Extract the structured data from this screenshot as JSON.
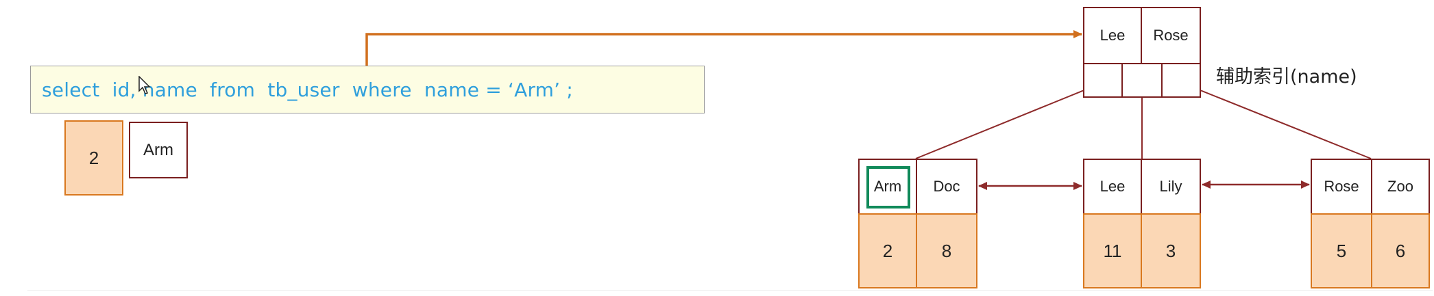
{
  "query": {
    "sql": "select  id, name  from  tb_user  where  name = ‘Arm’ ;"
  },
  "result_row": {
    "id": "2",
    "name": "Arm"
  },
  "index": {
    "label": "辅助索引(name)",
    "root": {
      "keys": [
        "Lee",
        "Rose"
      ]
    },
    "leaves": [
      {
        "keys": [
          "Arm",
          "Doc"
        ],
        "values": [
          "2",
          "8"
        ]
      },
      {
        "keys": [
          "Lee",
          "Lily"
        ],
        "values": [
          "11",
          "3"
        ]
      },
      {
        "keys": [
          "Rose",
          "Zoo"
        ],
        "values": [
          "5",
          "6"
        ]
      }
    ],
    "highlighted_key": "Arm"
  },
  "colors": {
    "query_text": "#2f9fdc",
    "query_box_bg": "#fdfde3",
    "node_border": "#7a1f1f",
    "value_fill": "#fbd7b5",
    "value_border": "#d9781f",
    "query_arrow": "#d16f1d",
    "tree_lines": "#8e2b2b",
    "highlight": "#118a5a"
  }
}
